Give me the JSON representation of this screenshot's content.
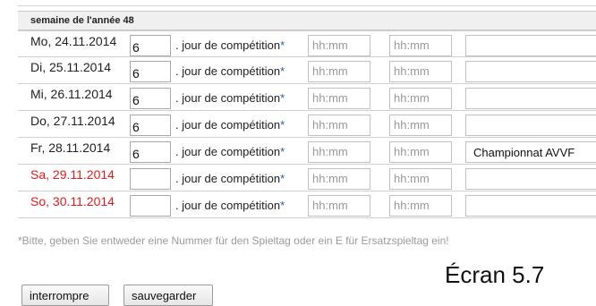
{
  "week_header": "semaine de l'année 48",
  "jour_label": ". jour de compétition",
  "required_mark": "*",
  "time_placeholder": "hh:mm",
  "rows": [
    {
      "date": "Mo, 24.11.2014",
      "number": "6",
      "start": "",
      "end": "",
      "remark": "",
      "weekend": false
    },
    {
      "date": "Di, 25.11.2014",
      "number": "6",
      "start": "",
      "end": "",
      "remark": "",
      "weekend": false
    },
    {
      "date": "Mi, 26.11.2014",
      "number": "6",
      "start": "",
      "end": "",
      "remark": "",
      "weekend": false
    },
    {
      "date": "Do, 27.11.2014",
      "number": "6",
      "start": "",
      "end": "",
      "remark": "",
      "weekend": false
    },
    {
      "date": "Fr, 28.11.2014",
      "number": "6",
      "start": "",
      "end": "",
      "remark": "Championnat AVVF",
      "weekend": false
    },
    {
      "date": "Sa, 29.11.2014",
      "number": "",
      "start": "",
      "end": "",
      "remark": "",
      "weekend": true
    },
    {
      "date": "So, 30.11.2014",
      "number": "",
      "start": "",
      "end": "",
      "remark": "",
      "weekend": true
    }
  ],
  "note": "*Bitte, geben Sie entweder eine Nummer für den Spieltag oder ein E für Ersatzspieltag ein!",
  "caption": "Écran 5.7",
  "buttons": {
    "cancel": "interrompre",
    "save": "sauvegarder"
  },
  "colors": {
    "weekend_date": "#e21b1b",
    "required_star": "#1e5fb4",
    "placeholder": "#999999"
  }
}
